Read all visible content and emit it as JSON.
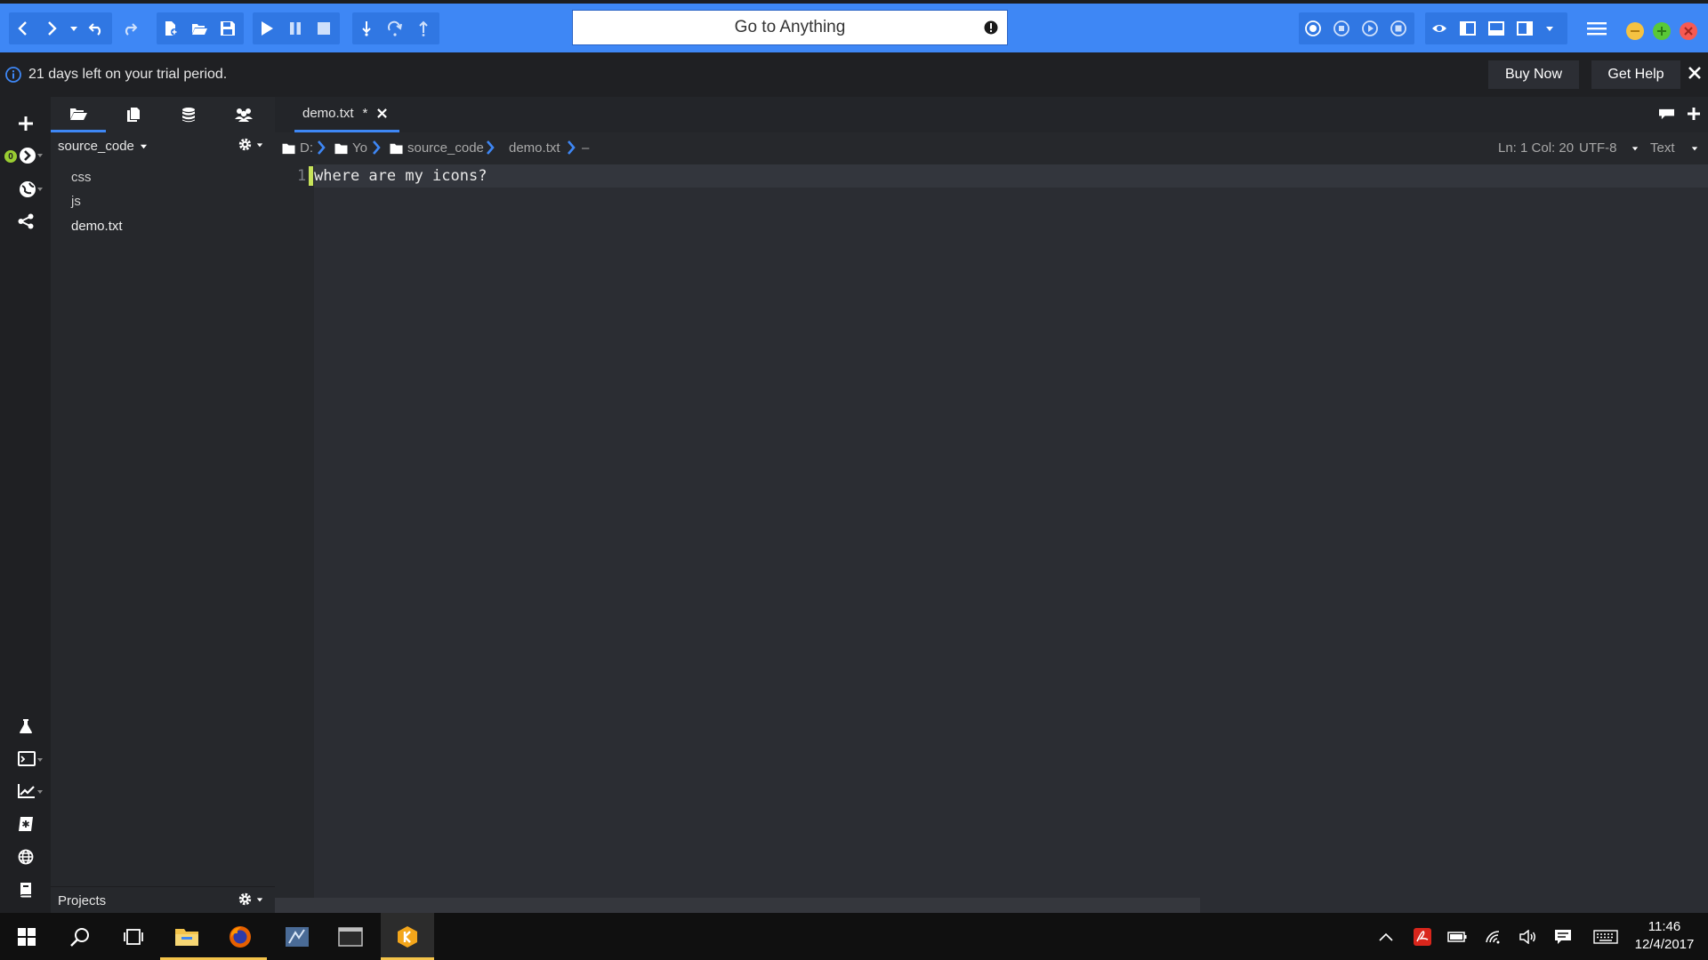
{
  "toolbar": {
    "goto_placeholder": "Go to Anything"
  },
  "trial": {
    "message": "21 days left on your trial period.",
    "buy_label": "Buy Now",
    "help_label": "Get Help"
  },
  "leftstrip": {
    "badge": "0"
  },
  "sidebar": {
    "project": "source_code",
    "items": [
      "css",
      "js",
      "demo.txt"
    ],
    "footer": "Projects"
  },
  "editor": {
    "tab_name": "demo.txt",
    "tab_modified": "*",
    "breadcrumbs": [
      "D:",
      "Yo",
      "source_code",
      "demo.txt",
      "–"
    ],
    "status": "Ln: 1 Col: 20",
    "encoding": "UTF-8",
    "language": "Text",
    "line_number": "1",
    "line_text": "where are my icons?"
  },
  "taskbar": {
    "time": "11:46",
    "date": "12/4/2017"
  },
  "colors": {
    "accent": "#3e87f5",
    "toolbar_bg": "#3e87f5",
    "minimize": "#f5c242",
    "maximize": "#59c837",
    "close": "#f65a52",
    "cursor": "#c7e35a"
  }
}
